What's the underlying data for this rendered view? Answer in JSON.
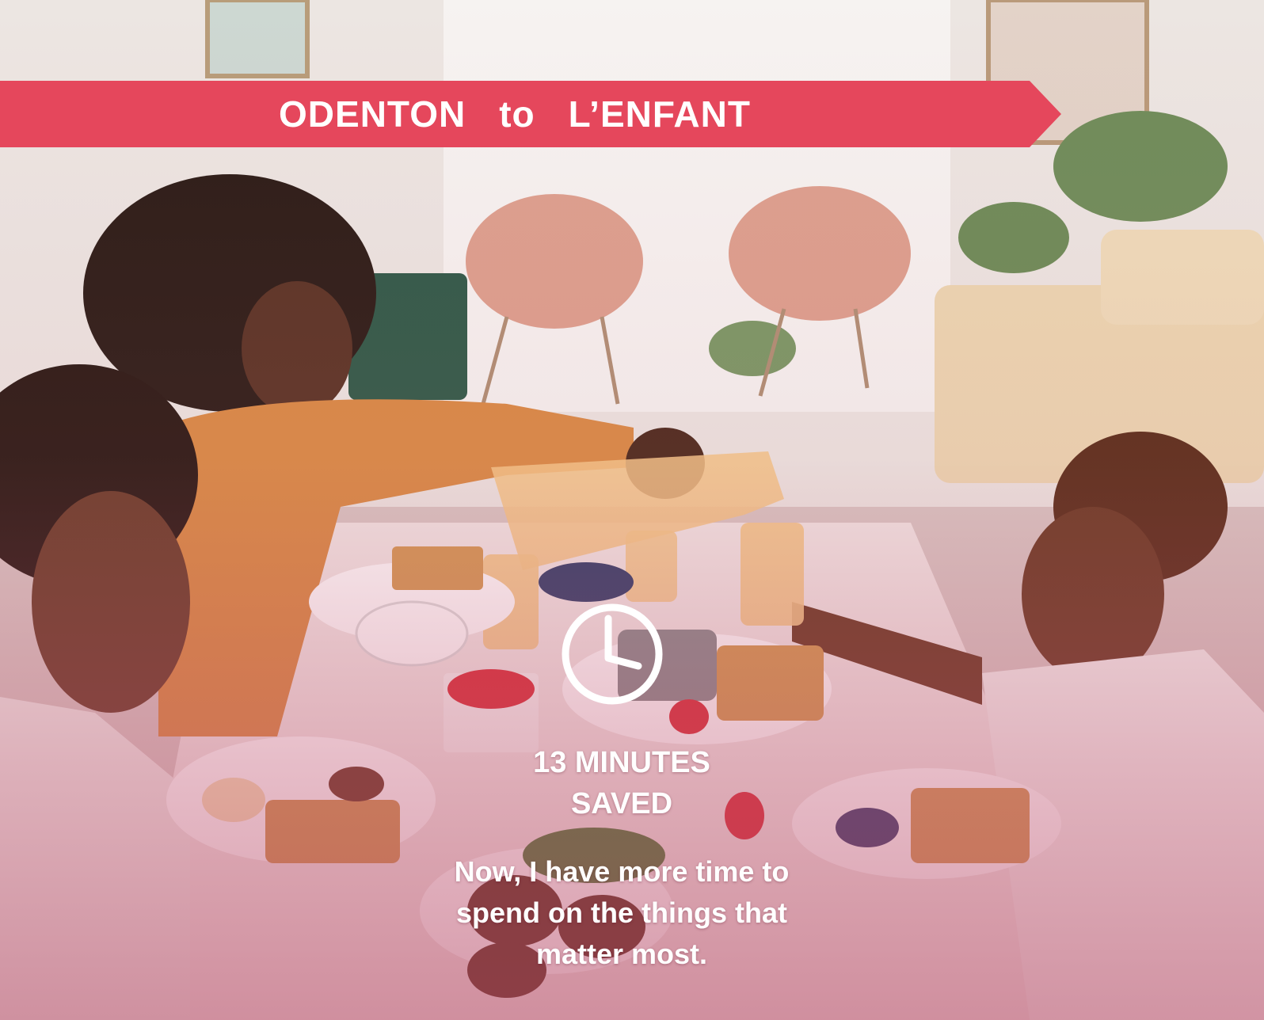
{
  "route": {
    "origin": "ODENTON",
    "connector": "to",
    "destination": "L’ENFANT"
  },
  "savings": {
    "line1": "13 MINUTES",
    "line2": "SAVED"
  },
  "quote": {
    "line1": "Now, I have more time to",
    "line2": "spend on the things that",
    "line3": "matter most."
  },
  "icons": {
    "clock": "clock-icon"
  },
  "colors": {
    "banner": "#e5475c",
    "overlay": "#c8607c",
    "text": "#ffffff"
  }
}
